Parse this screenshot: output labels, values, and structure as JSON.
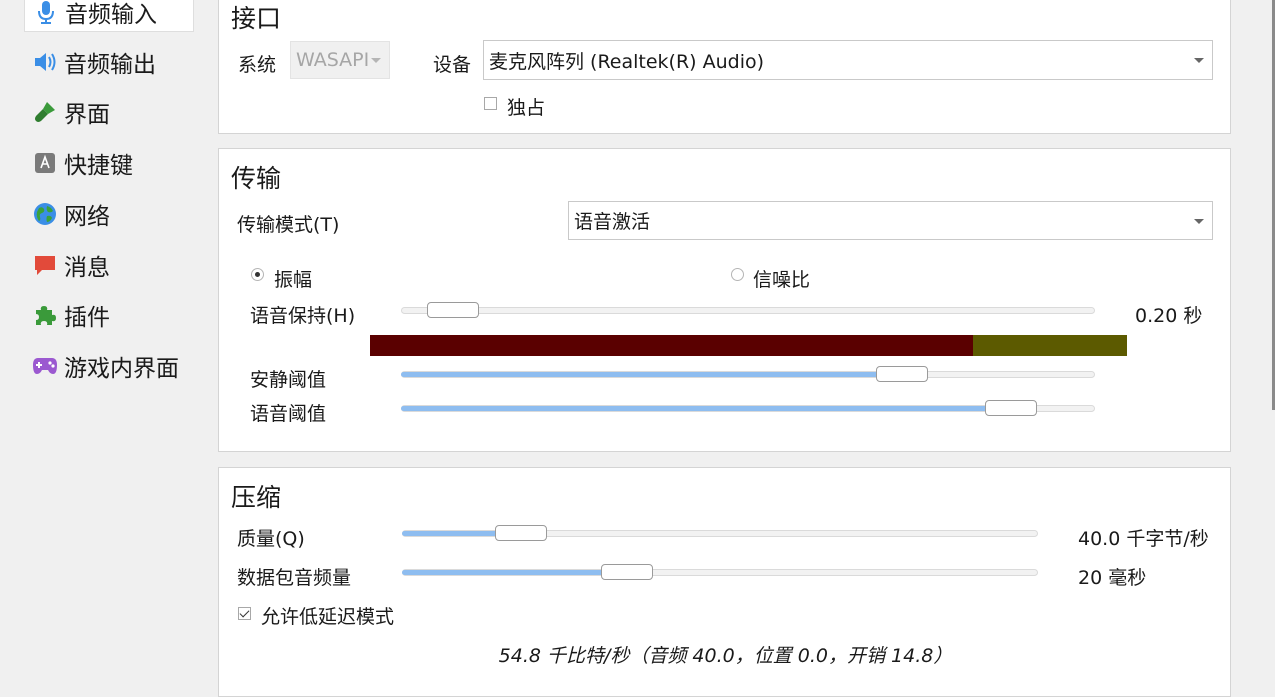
{
  "sidebar": {
    "items": [
      {
        "label": "音频输入",
        "icon": "microphone-icon"
      },
      {
        "label": "音频输出",
        "icon": "speaker-icon"
      },
      {
        "label": "界面",
        "icon": "paintbrush-icon"
      },
      {
        "label": "快捷键",
        "icon": "keyboard-key-icon"
      },
      {
        "label": "网络",
        "icon": "globe-icon"
      },
      {
        "label": "消息",
        "icon": "chat-bubble-icon"
      },
      {
        "label": "插件",
        "icon": "puzzle-piece-icon"
      },
      {
        "label": "游戏内界面",
        "icon": "gamepad-icon"
      }
    ]
  },
  "interface_panel": {
    "title": "接口",
    "system_label": "系统",
    "system_value": "WASAPI",
    "device_label": "设备",
    "device_value": "麦克风阵列 (Realtek(R) Audio)",
    "exclusive_label": "独占",
    "exclusive_checked": false
  },
  "transmission_panel": {
    "title": "传输",
    "mode_label": "传输模式(T)",
    "mode_value": "语音激活",
    "amplitude_label": "振幅",
    "snr_label": "信噪比",
    "selected": "amplitude",
    "voice_hold_label": "语音保持(H)",
    "voice_hold_value": "0.20 秒",
    "voice_hold_fraction": 0.04,
    "silence_threshold_label": "安静阈值",
    "silence_threshold_fraction": 0.74,
    "speech_threshold_label": "语音阈值",
    "speech_threshold_fraction": 0.91,
    "vad_colors": {
      "silence": "#5a0000",
      "between": "#5c5a00",
      "speech": "#006400"
    }
  },
  "compression_panel": {
    "title": "压缩",
    "quality_label": "质量(Q)",
    "quality_value": "40.0 千字节/秒",
    "quality_fraction": 0.16,
    "packet_label": "数据包音频量",
    "packet_value": "20 毫秒",
    "packet_fraction": 0.34,
    "low_latency_label": "允许低延迟模式",
    "low_latency_checked": true,
    "bitrate_summary": "54.8 千比特/秒（音频 40.0，位置 0.0，开销 14.8）"
  },
  "colors": {
    "accent_fill": "#8ebdf0",
    "panel_bg": "#ffffff",
    "window_bg": "#f0f0f0"
  }
}
